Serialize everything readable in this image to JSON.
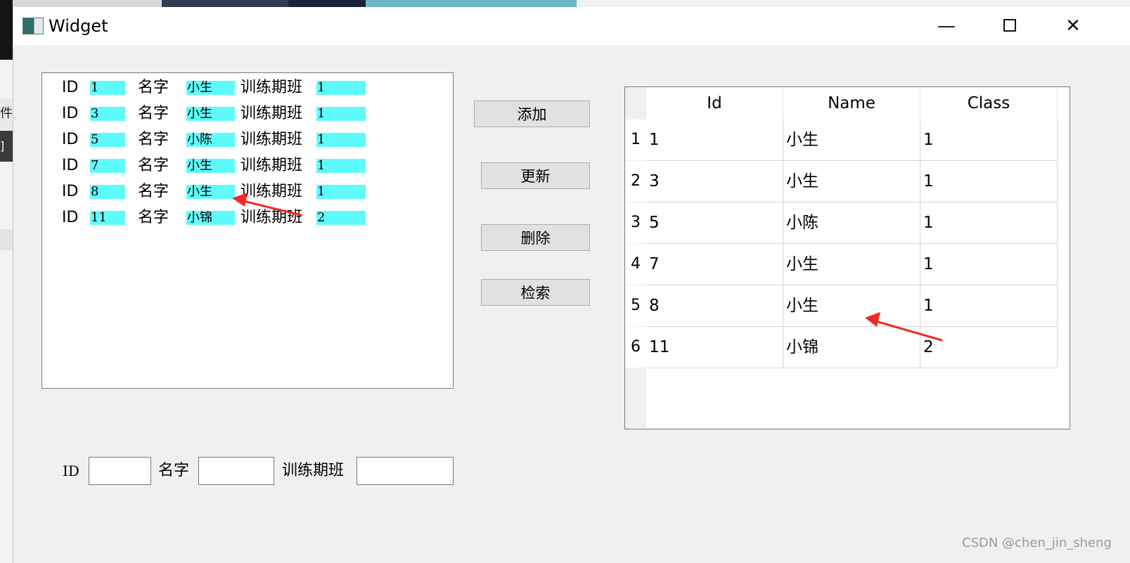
{
  "window": {
    "title": "Widget",
    "controls": {
      "minimize": "—",
      "close": "✕"
    }
  },
  "desktop": {
    "left_tab_text": "件",
    "left_dark_text": "]"
  },
  "list_panel": {
    "labels": {
      "id": "ID",
      "name": "名字",
      "class": "训练期班"
    },
    "rows": [
      {
        "id": "1",
        "name": "小生",
        "class": "1"
      },
      {
        "id": "3",
        "name": "小生",
        "class": "1"
      },
      {
        "id": "5",
        "name": "小陈",
        "class": "1"
      },
      {
        "id": "7",
        "name": "小生",
        "class": "1"
      },
      {
        "id": "8",
        "name": "小生",
        "class": "1"
      },
      {
        "id": "11",
        "name": "小锦",
        "class": "2"
      }
    ],
    "highlight_color": "#5ffbfb"
  },
  "buttons": {
    "add": "添加",
    "update": "更新",
    "delete": "删除",
    "search": "检索"
  },
  "table": {
    "columns": [
      "Id",
      "Name",
      "Class"
    ],
    "rows": [
      {
        "header": "1",
        "cells": [
          "1",
          "小生",
          "1"
        ]
      },
      {
        "header": "2",
        "cells": [
          "3",
          "小生",
          "1"
        ]
      },
      {
        "header": "3",
        "cells": [
          "5",
          "小陈",
          "1"
        ]
      },
      {
        "header": "4",
        "cells": [
          "7",
          "小生",
          "1"
        ]
      },
      {
        "header": "5",
        "cells": [
          "8",
          "小生",
          "1"
        ]
      },
      {
        "header": "6",
        "cells": [
          "11",
          "小锦",
          "2"
        ]
      }
    ]
  },
  "form": {
    "id_label": "ID",
    "name_label": "名字",
    "class_label": "训练期班",
    "id_value": "",
    "name_value": "",
    "class_value": ""
  },
  "annotation": {
    "arrow_color": "#ee2a24"
  },
  "watermark": "CSDN @chen_jin_sheng"
}
